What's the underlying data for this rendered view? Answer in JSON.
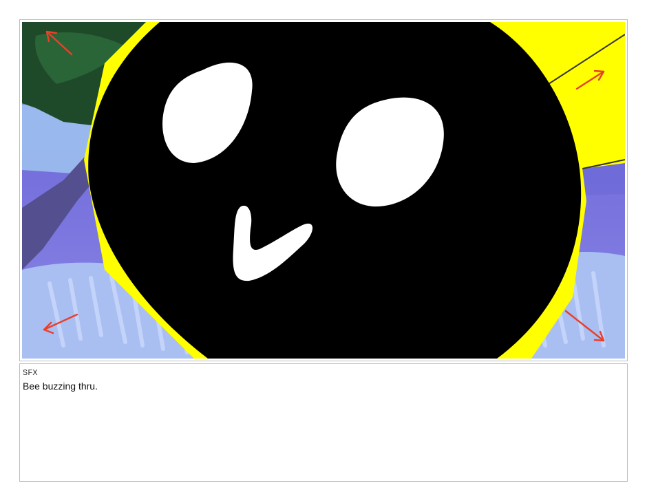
{
  "storyboard": {
    "notes_label": "SFX",
    "notes_text": "Bee buzzing thru."
  },
  "artwork": {
    "subject": "bee-face-closeup",
    "colors": {
      "bee_body": "#000000",
      "bee_eyes": "#ffffff",
      "bee_stripe": "#ffff00",
      "tree_foliage": "#1f4a2a",
      "sky": "#7a78e0",
      "ground_brush": "#9fb6f0",
      "motion_arrows": "#e8402a"
    }
  }
}
